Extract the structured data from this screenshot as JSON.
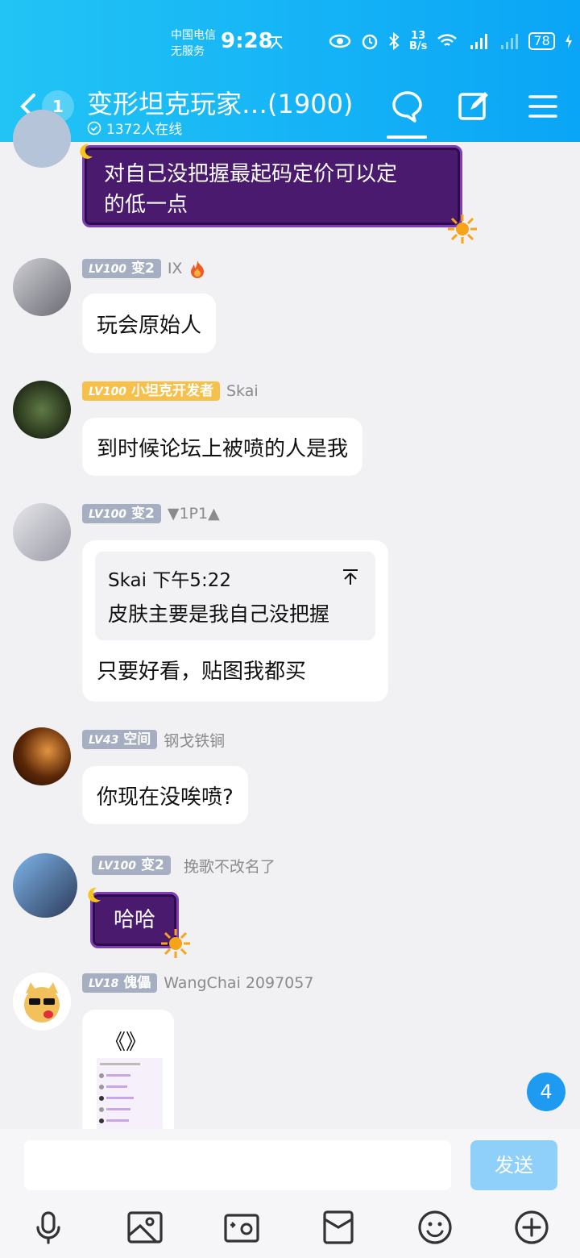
{
  "status_bar": {
    "carrier_line1": "中国电信",
    "carrier_line2": "无服务",
    "time": "9:28",
    "net_speed_value": "13",
    "net_speed_unit": "B/s",
    "battery": "78"
  },
  "header": {
    "unread_count": "1",
    "title": "变形坦克玩家…(1900)",
    "online": "1372人在线"
  },
  "messages": [
    {
      "text_line1": "对自己没把握最起码定价可以定",
      "text_line2": "的低一点"
    },
    {
      "level": "LV100",
      "title": "变2",
      "nick": "IX",
      "text": "玩会原始人"
    },
    {
      "level": "LV100",
      "title": "小坦克开发者",
      "nick": "Skai",
      "text": "到时候论坛上被喷的人是我"
    },
    {
      "level": "LV100",
      "title": "变2",
      "nick": "▼1P1▲",
      "quote_author": "Skai 下午5:22",
      "quote_text": "皮肤主要是我自己没把握",
      "text": "只要好看，贴图我都买"
    },
    {
      "level": "LV43",
      "title": "空间",
      "nick": "钢戈铁锏",
      "text": "你现在没唉喷?"
    },
    {
      "level": "LV100",
      "title": "变2",
      "nick": "挽歌不改名了",
      "text": "哈哈"
    },
    {
      "level": "LV18",
      "title": "傀儡",
      "nick": "WangChai 2097057",
      "text": "《》"
    }
  ],
  "new_messages_count": "4",
  "input": {
    "send_label": "发送"
  },
  "colors": {
    "header": "#0aa5f6",
    "badge_gray": "#a6aec2",
    "badge_gold": "#f6c04a"
  }
}
